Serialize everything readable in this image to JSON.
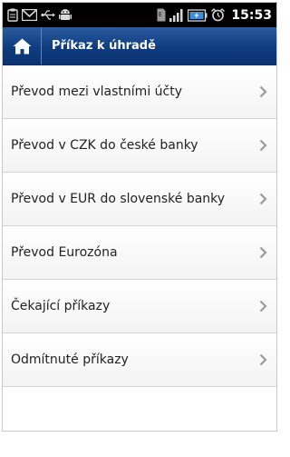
{
  "status_bar": {
    "time": "15:53",
    "icons": [
      "clipboard-icon",
      "gmail-icon",
      "usb-icon",
      "android-icon",
      "sim-icon",
      "signal-icon",
      "battery-icon",
      "alarm-icon"
    ]
  },
  "header": {
    "home_icon": "home-icon",
    "title": "Příkaz k úhradě",
    "background_color": "#0f3c7e"
  },
  "menu": {
    "items": [
      {
        "label": "Převod mezi vlastními účty"
      },
      {
        "label": "Převod v CZK do české banky"
      },
      {
        "label": "Převod v EUR do slovenské banky"
      },
      {
        "label": "Převod Eurozóna"
      },
      {
        "label": "Čekající příkazy"
      },
      {
        "label": "Odmítnuté příkazy"
      }
    ]
  }
}
